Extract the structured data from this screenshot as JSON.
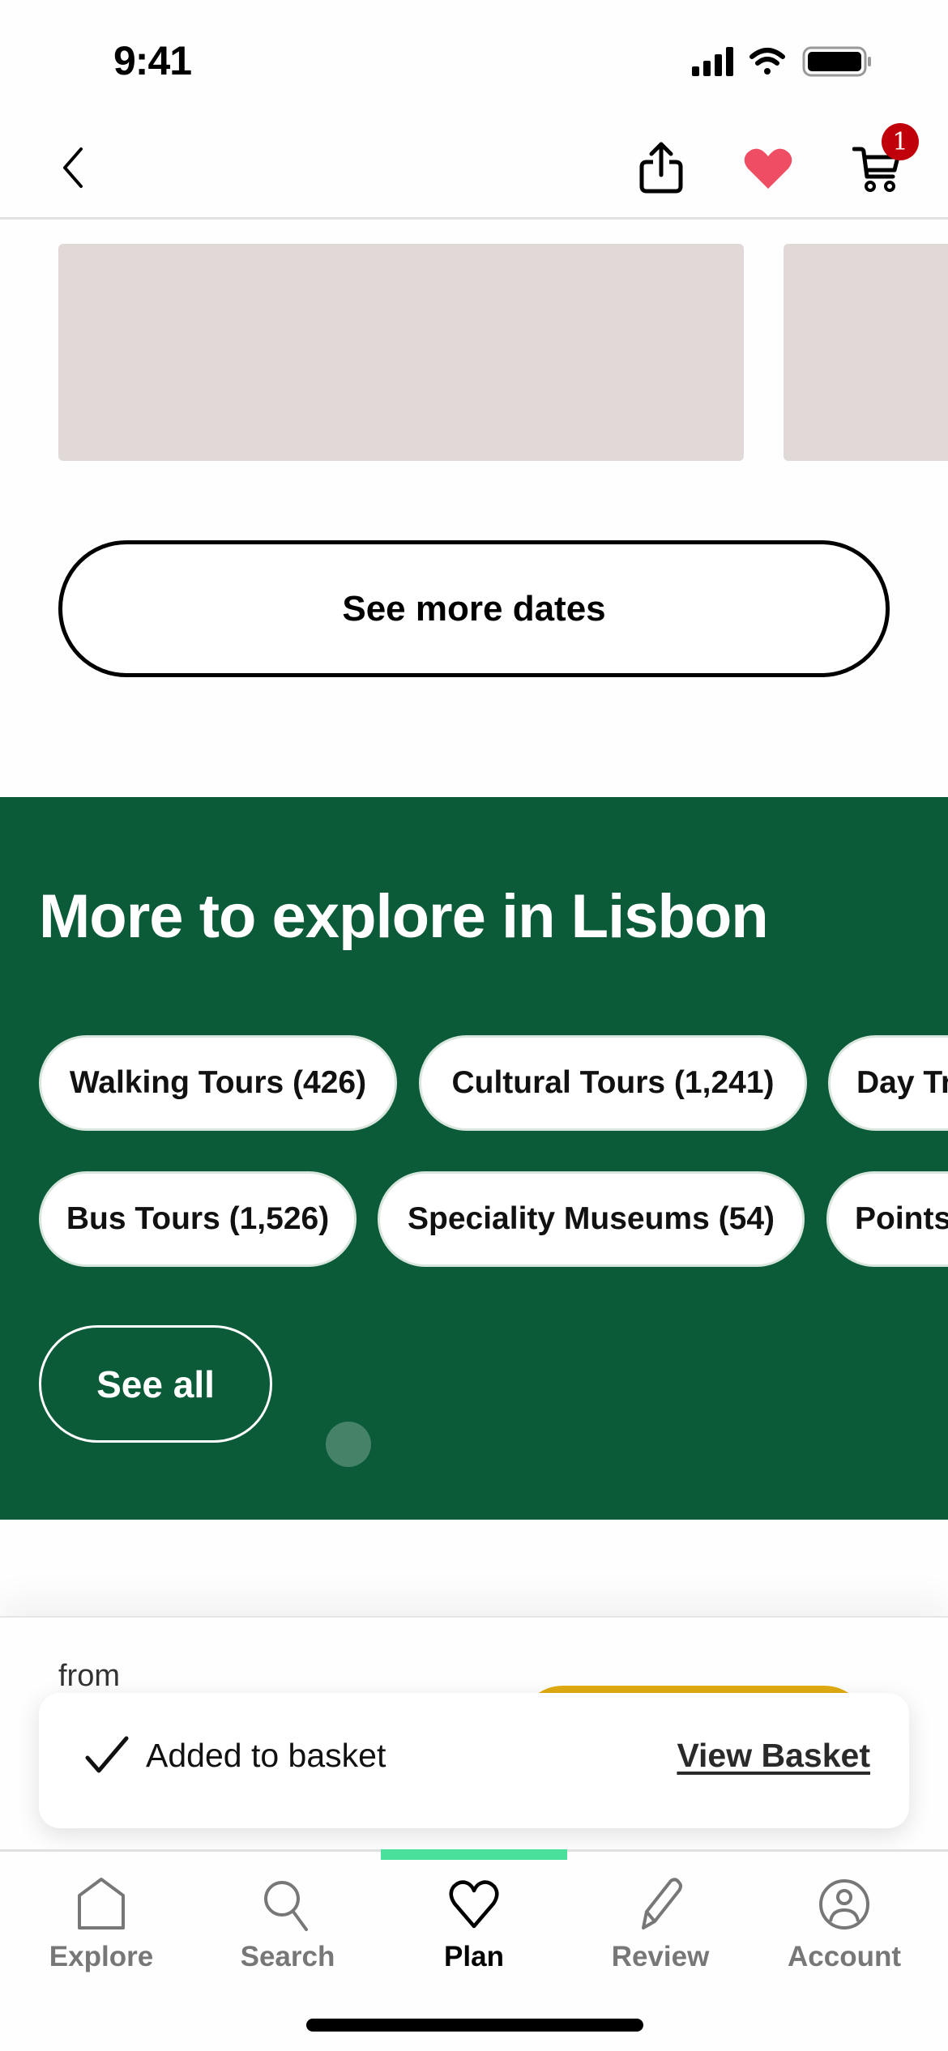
{
  "status_bar": {
    "time": "9:41",
    "icons": [
      "cellular-signal-icon",
      "wifi-icon",
      "battery-icon"
    ]
  },
  "header": {
    "back_icon": "chevron-left-icon",
    "share_icon": "share-icon",
    "favorite_icon": "heart-filled-icon",
    "favorite_color": "#ef4d64",
    "cart_icon": "shopping-cart-icon",
    "cart_badge_count": "1",
    "cart_badge_color": "#c0000b"
  },
  "dates": {
    "see_more_label": "See more dates"
  },
  "explore": {
    "title": "More to explore in Lisbon",
    "background_color": "#0b5b38",
    "chips_row_1": [
      {
        "label": "Walking Tours (426)"
      },
      {
        "label": "Cultural Tours (1,241)"
      },
      {
        "label": "Day Tr"
      }
    ],
    "chips_row_2": [
      {
        "label": "Bus Tours (1,526)"
      },
      {
        "label": "Speciality Museums (54)"
      },
      {
        "label": "Points"
      }
    ],
    "see_all_label": "See all"
  },
  "booking_bar": {
    "from_label": "from",
    "button_color": "#e1ac12"
  },
  "toast": {
    "icon": "checkmark-icon",
    "message": "Added to basket",
    "action_label": "View Basket"
  },
  "tab_bar": {
    "active_indicator_color": "#48e09b",
    "tabs": [
      {
        "label": "Explore",
        "icon": "home-icon",
        "active": false
      },
      {
        "label": "Search",
        "icon": "search-icon",
        "active": false
      },
      {
        "label": "Plan",
        "icon": "heart-outline-icon",
        "active": true
      },
      {
        "label": "Review",
        "icon": "pencil-icon",
        "active": false
      },
      {
        "label": "Account",
        "icon": "account-icon",
        "active": false
      }
    ]
  }
}
